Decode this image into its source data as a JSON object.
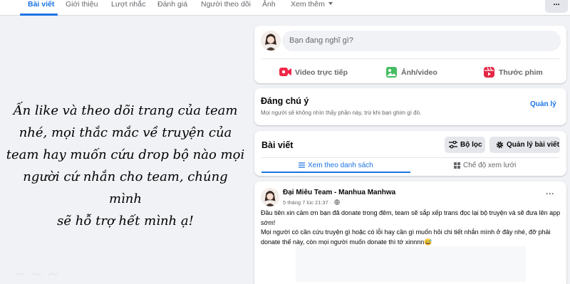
{
  "nav": {
    "tabs": [
      {
        "label": "Bài viết",
        "active": true
      },
      {
        "label": "Giới thiệu"
      },
      {
        "label": "Lượt nhắc"
      },
      {
        "label": "Đánh giá"
      },
      {
        "label": "Người theo dõi"
      },
      {
        "label": "Ảnh"
      },
      {
        "label": "Xem thêm"
      }
    ],
    "more_button": "..."
  },
  "left_panel": {
    "lines": [
      "Ấn like và theo dõi trang của team",
      "nhé, mọi thắc mắc về truyện của",
      "team hay muốn cứu drop bộ nào mọi",
      "người cứ nhắn cho team, chúng mình",
      "sẽ hỗ trợ hết mình ạ!"
    ]
  },
  "composer": {
    "placeholder": "Bạn đang nghĩ gì?",
    "actions": [
      {
        "label": "Video trực tiếp",
        "icon": "live-video-icon",
        "color": "#f02849"
      },
      {
        "label": "Ảnh/video",
        "icon": "photo-video-icon",
        "color": "#45bd62"
      },
      {
        "label": "Thước phim",
        "icon": "reels-icon",
        "color": "#e42645"
      }
    ]
  },
  "notice": {
    "title": "Đáng chú ý",
    "description": "Mọi người sẽ không nhìn thấy phần này, trừ khi bạn ghim gì đó.",
    "manage_label": "Quản lý"
  },
  "posts_header": {
    "title": "Bài viết",
    "filter_label": "Bộ lọc",
    "manage_label": "Quản lý bài viết",
    "view_list_label": "Xem theo danh sách",
    "view_grid_label": "Chế độ xem lưới"
  },
  "post": {
    "author": "Đại Miêu Team - Manhua Manhwa",
    "time": "5 tháng 7 lúc 21:37 ·",
    "more": "···",
    "paragraphs": [
      "Đầu tiên xin cảm ơn bạn đã donate trong đêm, team sẽ sắp xếp trans đọc lại bộ truyện và sẽ đưa lên app sớm!",
      "Mọi người có cần cứu truyện gì hoặc có lỗi hay cần gì muốn hỏi chi tiết nhắn mình ở đây nhé, đỡ phải donate thế này, còn mọi người muốn donate thì tớ xinnnn😅"
    ]
  },
  "colors": {
    "accent": "#1b74e4",
    "background": "#f0f2f5",
    "text_secondary": "#65676b"
  }
}
